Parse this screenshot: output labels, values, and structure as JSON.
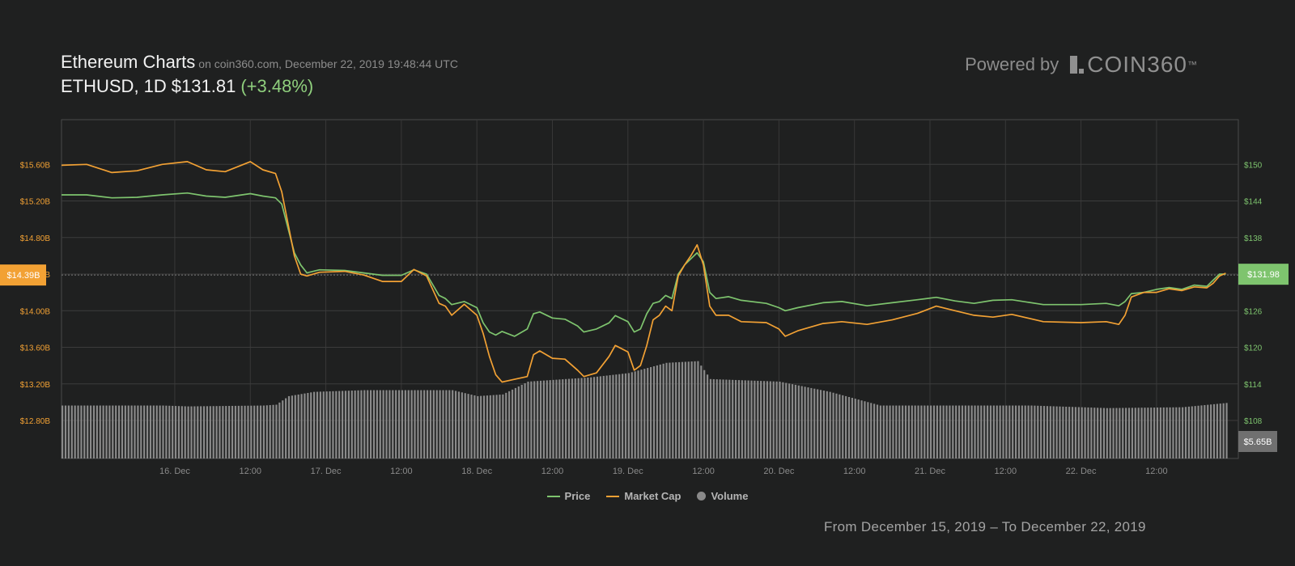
{
  "header": {
    "title": "Ethereum Charts",
    "meta": "on coin360.com, December 22, 2019 19:48:44 UTC",
    "ticker": "ETHUSD, 1D",
    "price": "$131.81",
    "change": "(+3.48%)"
  },
  "brand": {
    "powered": "Powered by",
    "logo": "COIN360",
    "tm": "™"
  },
  "legend": {
    "price": "Price",
    "market_cap": "Market Cap",
    "volume": "Volume"
  },
  "range_text": "From December 15, 2019 – To December 22, 2019",
  "colors": {
    "background": "#1f2020",
    "price": "#7ec46e",
    "market_cap": "#f2a134",
    "volume": "#8a8a8a",
    "price_badge": "#7ec46e",
    "cap_badge": "#f2a134",
    "volume_badge": "#707070"
  },
  "chart_data": {
    "type": "line",
    "x_ticks": [
      "16. Dec",
      "12:00",
      "17. Dec",
      "12:00",
      "18. Dec",
      "12:00",
      "19. Dec",
      "12:00",
      "20. Dec",
      "12:00",
      "21. Dec",
      "12:00",
      "22. Dec",
      "12:00"
    ],
    "left_axis": {
      "ticks": [
        "$15.60B",
        "$15.20B",
        "$14.80B",
        "$14.40B",
        "$14.00B",
        "$13.60B",
        "$13.20B",
        "$12.80B"
      ],
      "values": [
        15.6,
        15.2,
        14.8,
        14.4,
        14.0,
        13.6,
        13.2,
        12.8
      ],
      "ylim": [
        12.8,
        16.0
      ]
    },
    "right_axis": {
      "ticks": [
        "$150",
        "$144",
        "$138",
        "$132",
        "$126",
        "$120",
        "$114",
        "$108"
      ],
      "values": [
        150,
        144,
        138,
        132,
        126,
        120,
        114,
        108
      ],
      "ylim": [
        108,
        156
      ]
    },
    "current": {
      "market_cap_label": "$14.39B",
      "market_cap": 14.39,
      "price_label": "$131.98",
      "price": 131.98,
      "volume_label": "$5.65B"
    },
    "time_range_hours": [
      -18,
      169
    ],
    "series": [
      {
        "name": "Price",
        "axis": "right",
        "points": [
          [
            -18,
            145.0
          ],
          [
            -14,
            145.0
          ],
          [
            -10,
            144.5
          ],
          [
            -6,
            144.6
          ],
          [
            -2,
            145.0
          ],
          [
            2,
            145.3
          ],
          [
            5,
            144.8
          ],
          [
            8,
            144.6
          ],
          [
            12,
            145.2
          ],
          [
            14,
            144.8
          ],
          [
            16,
            144.5
          ],
          [
            17,
            143.5
          ],
          [
            18,
            139.5
          ],
          [
            19,
            135.5
          ],
          [
            20,
            133.5
          ],
          [
            21,
            132.2
          ],
          [
            23,
            132.7
          ],
          [
            27,
            132.6
          ],
          [
            30,
            132.2
          ],
          [
            33,
            131.8
          ],
          [
            36,
            131.8
          ],
          [
            38,
            132.7
          ],
          [
            40,
            132.0
          ],
          [
            42,
            128.5
          ],
          [
            43,
            128.0
          ],
          [
            44,
            127.0
          ],
          [
            46,
            127.5
          ],
          [
            48,
            126.5
          ],
          [
            49,
            124.0
          ],
          [
            50,
            122.5
          ],
          [
            51,
            122.0
          ],
          [
            52,
            122.6
          ],
          [
            54,
            121.8
          ],
          [
            56,
            123.0
          ],
          [
            57,
            125.5
          ],
          [
            58,
            125.8
          ],
          [
            60,
            124.8
          ],
          [
            62,
            124.6
          ],
          [
            64,
            123.5
          ],
          [
            65,
            122.5
          ],
          [
            67,
            123.0
          ],
          [
            69,
            124.0
          ],
          [
            70,
            125.2
          ],
          [
            72,
            124.2
          ],
          [
            73,
            122.5
          ],
          [
            74,
            123.0
          ],
          [
            75,
            125.5
          ],
          [
            76,
            127.2
          ],
          [
            77,
            127.5
          ],
          [
            78,
            128.5
          ],
          [
            79,
            128.0
          ],
          [
            80,
            132.0
          ],
          [
            81,
            133.5
          ],
          [
            82,
            134.5
          ],
          [
            83,
            135.5
          ],
          [
            84,
            134.0
          ],
          [
            85,
            129.0
          ],
          [
            86,
            128.0
          ],
          [
            88,
            128.3
          ],
          [
            90,
            127.7
          ],
          [
            94,
            127.2
          ],
          [
            96,
            126.5
          ],
          [
            97,
            126.0
          ],
          [
            99,
            126.5
          ],
          [
            103,
            127.3
          ],
          [
            106,
            127.5
          ],
          [
            110,
            126.8
          ],
          [
            114,
            127.3
          ],
          [
            118,
            127.8
          ],
          [
            121,
            128.2
          ],
          [
            124,
            127.6
          ],
          [
            127,
            127.2
          ],
          [
            130,
            127.7
          ],
          [
            133,
            127.8
          ],
          [
            138,
            127.0
          ],
          [
            144,
            127.0
          ],
          [
            148,
            127.2
          ],
          [
            150,
            126.8
          ],
          [
            151,
            127.5
          ],
          [
            152,
            128.8
          ],
          [
            154,
            129.0
          ],
          [
            156,
            129.5
          ],
          [
            158,
            129.8
          ],
          [
            160,
            129.5
          ],
          [
            162,
            130.2
          ],
          [
            164,
            130.0
          ],
          [
            165,
            131.0
          ],
          [
            166,
            132.0
          ],
          [
            167,
            132.0
          ]
        ]
      },
      {
        "name": "Market Cap",
        "axis": "left",
        "points": [
          [
            -18,
            15.59
          ],
          [
            -14,
            15.6
          ],
          [
            -10,
            15.51
          ],
          [
            -6,
            15.53
          ],
          [
            -2,
            15.6
          ],
          [
            2,
            15.63
          ],
          [
            5,
            15.54
          ],
          [
            8,
            15.52
          ],
          [
            12,
            15.63
          ],
          [
            14,
            15.54
          ],
          [
            16,
            15.5
          ],
          [
            17,
            15.3
          ],
          [
            18,
            14.95
          ],
          [
            19,
            14.6
          ],
          [
            20,
            14.4
          ],
          [
            21,
            14.38
          ],
          [
            23,
            14.42
          ],
          [
            27,
            14.43
          ],
          [
            30,
            14.39
          ],
          [
            33,
            14.32
          ],
          [
            36,
            14.32
          ],
          [
            38,
            14.45
          ],
          [
            40,
            14.38
          ],
          [
            42,
            14.08
          ],
          [
            43,
            14.05
          ],
          [
            44,
            13.95
          ],
          [
            46,
            14.07
          ],
          [
            48,
            13.95
          ],
          [
            49,
            13.75
          ],
          [
            50,
            13.5
          ],
          [
            51,
            13.3
          ],
          [
            52,
            13.22
          ],
          [
            54,
            13.25
          ],
          [
            56,
            13.28
          ],
          [
            57,
            13.52
          ],
          [
            58,
            13.56
          ],
          [
            60,
            13.48
          ],
          [
            62,
            13.47
          ],
          [
            64,
            13.35
          ],
          [
            65,
            13.28
          ],
          [
            67,
            13.32
          ],
          [
            69,
            13.5
          ],
          [
            70,
            13.62
          ],
          [
            72,
            13.55
          ],
          [
            73,
            13.35
          ],
          [
            74,
            13.4
          ],
          [
            75,
            13.62
          ],
          [
            76,
            13.9
          ],
          [
            77,
            13.95
          ],
          [
            78,
            14.05
          ],
          [
            79,
            14.0
          ],
          [
            80,
            14.38
          ],
          [
            81,
            14.5
          ],
          [
            82,
            14.6
          ],
          [
            83,
            14.72
          ],
          [
            84,
            14.5
          ],
          [
            85,
            14.05
          ],
          [
            86,
            13.95
          ],
          [
            88,
            13.95
          ],
          [
            90,
            13.88
          ],
          [
            94,
            13.87
          ],
          [
            96,
            13.8
          ],
          [
            97,
            13.72
          ],
          [
            99,
            13.78
          ],
          [
            103,
            13.86
          ],
          [
            106,
            13.88
          ],
          [
            110,
            13.85
          ],
          [
            114,
            13.9
          ],
          [
            118,
            13.97
          ],
          [
            121,
            14.05
          ],
          [
            124,
            14.0
          ],
          [
            127,
            13.95
          ],
          [
            130,
            13.93
          ],
          [
            133,
            13.96
          ],
          [
            138,
            13.88
          ],
          [
            144,
            13.87
          ],
          [
            148,
            13.88
          ],
          [
            150,
            13.85
          ],
          [
            151,
            13.95
          ],
          [
            152,
            14.15
          ],
          [
            154,
            14.2
          ],
          [
            156,
            14.2
          ],
          [
            158,
            14.24
          ],
          [
            160,
            14.22
          ],
          [
            162,
            14.26
          ],
          [
            164,
            14.25
          ],
          [
            165,
            14.3
          ],
          [
            166,
            14.38
          ],
          [
            167,
            14.41
          ]
        ]
      },
      {
        "name": "Volume",
        "type": "bar",
        "unit": "$B",
        "points": [
          [
            -18,
            6.2
          ],
          [
            -2,
            6.2
          ],
          [
            2,
            6.1
          ],
          [
            14,
            6.2
          ],
          [
            16,
            6.3
          ],
          [
            18,
            7.3
          ],
          [
            22,
            7.8
          ],
          [
            30,
            8.0
          ],
          [
            44,
            8.0
          ],
          [
            48,
            7.3
          ],
          [
            52,
            7.5
          ],
          [
            56,
            9.0
          ],
          [
            66,
            9.5
          ],
          [
            72,
            10.0
          ],
          [
            78,
            11.2
          ],
          [
            83,
            11.4
          ],
          [
            85,
            9.3
          ],
          [
            96,
            9.0
          ],
          [
            104,
            7.8
          ],
          [
            112,
            6.2
          ],
          [
            136,
            6.2
          ],
          [
            148,
            5.9
          ],
          [
            160,
            6.0
          ],
          [
            167,
            6.5
          ]
        ]
      }
    ]
  }
}
